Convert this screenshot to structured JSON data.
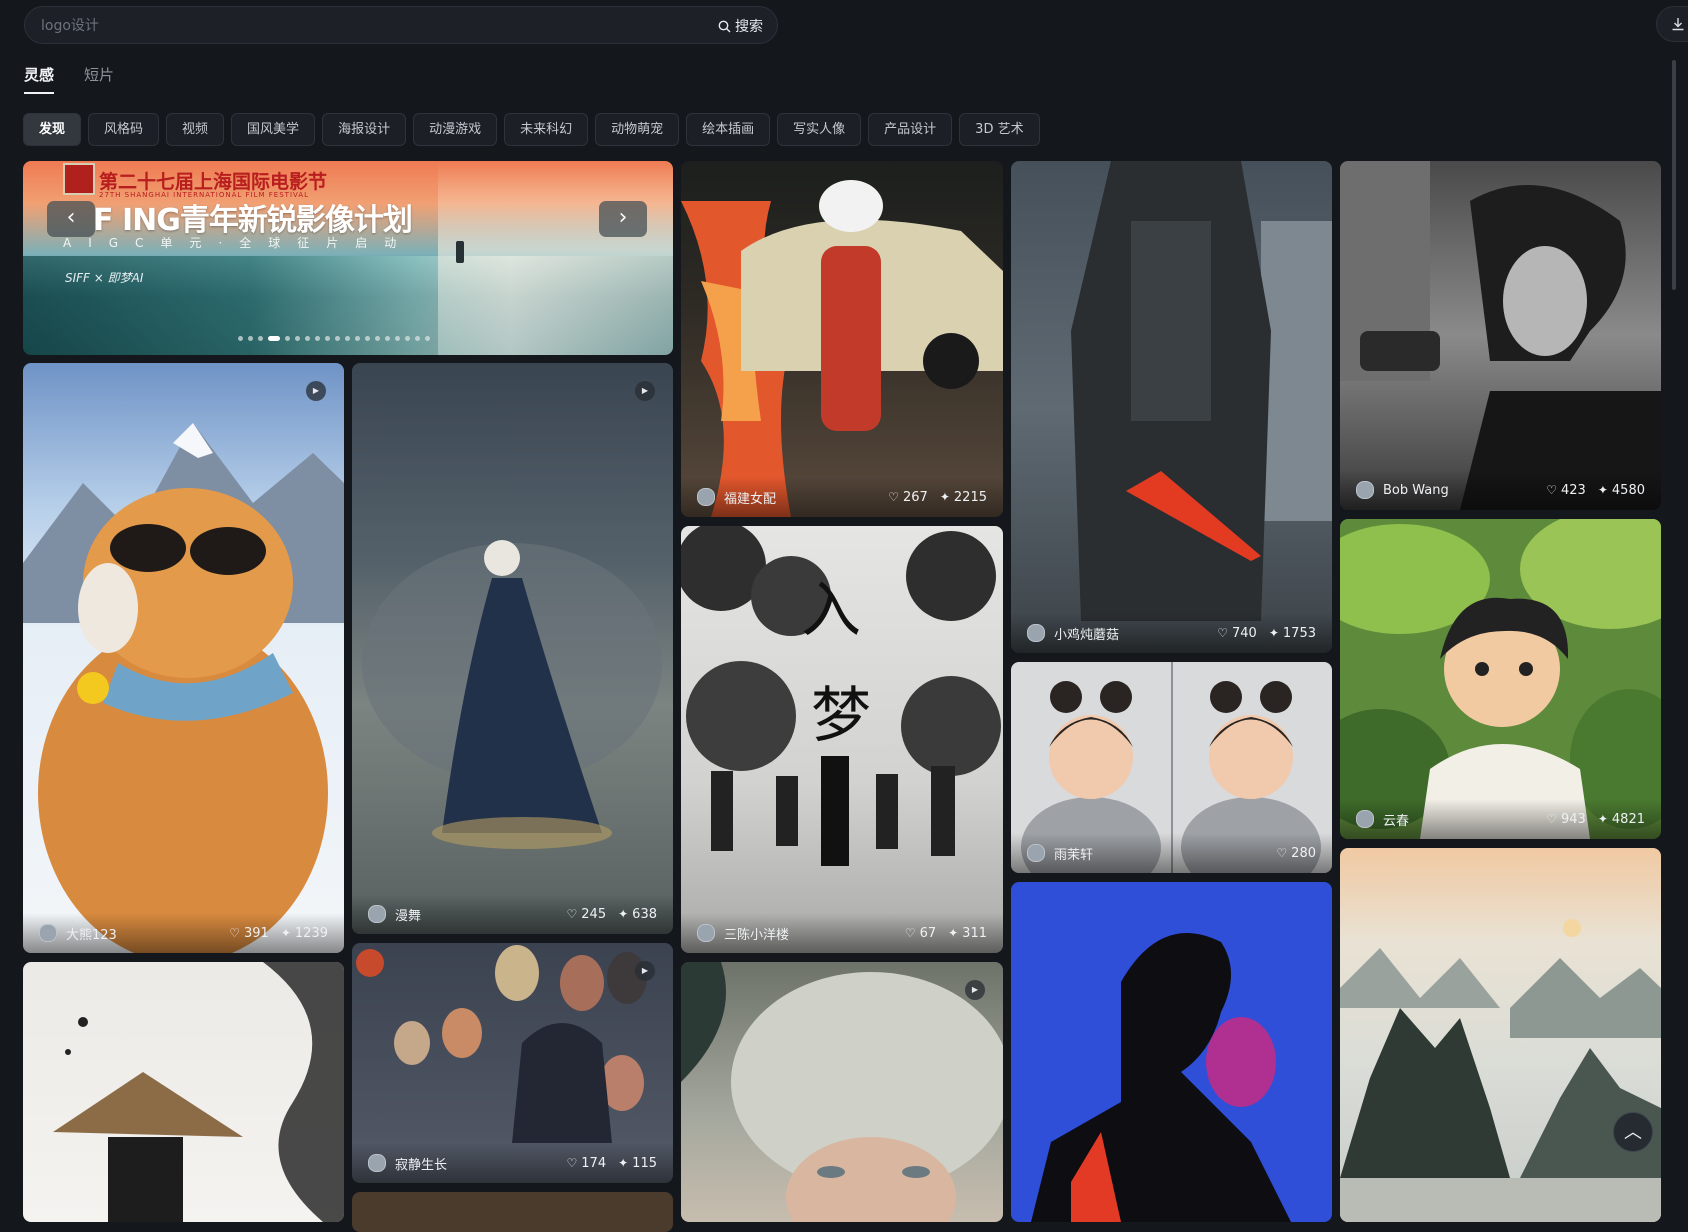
{
  "search": {
    "placeholder": "logo设计",
    "button_label": "搜索"
  },
  "tabs": [
    {
      "label": "灵感"
    },
    {
      "label": "短片"
    }
  ],
  "categories": [
    {
      "label": "发现"
    },
    {
      "label": "风格码"
    },
    {
      "label": "视频"
    },
    {
      "label": "国风美学"
    },
    {
      "label": "海报设计"
    },
    {
      "label": "动漫游戏"
    },
    {
      "label": "未来科幻"
    },
    {
      "label": "动物萌宠"
    },
    {
      "label": "绘本插画"
    },
    {
      "label": "写实人像"
    },
    {
      "label": "产品设计"
    },
    {
      "label": "3D 艺术"
    }
  ],
  "banner": {
    "festival_title": "第二十七届上海国际电影节",
    "festival_en": "27TH SHANGHAI INTERNATIONAL FILM FESTIVAL",
    "headline": "F ING青年新锐影像计划",
    "subline": "AIGC单元·全球征片启动",
    "brand": "SIFF × 即梦AI",
    "slide_count": 19,
    "active_slide": 3
  },
  "cards": [
    {
      "author": "大熊123",
      "likes": "391",
      "uses": "1239",
      "has_video": true
    },
    {
      "author": "漫舞",
      "likes": "245",
      "uses": "638",
      "has_video": true
    },
    {
      "author": "福建女配",
      "likes": "267",
      "uses": "2215",
      "has_video": false
    },
    {
      "author": "小鸡炖蘑菇",
      "likes": "740",
      "uses": "1753",
      "has_video": false
    },
    {
      "author": "Bob Wang",
      "likes": "423",
      "uses": "4580",
      "has_video": false
    },
    {
      "author": "三陈小洋楼",
      "likes": "67",
      "uses": "311",
      "has_video": false
    },
    {
      "author": "雨茉轩",
      "likes": "",
      "uses": "280",
      "has_video": false
    },
    {
      "author": "云春",
      "likes": "943",
      "uses": "4821",
      "has_video": false
    },
    {
      "author": "寂静生长",
      "likes": "174",
      "uses": "115",
      "has_video": true
    }
  ],
  "colors": {
    "background": "#14171c",
    "chip": "#1c2026",
    "chip_active": "#33383f",
    "accent_red": "#e23a24"
  },
  "icons": {
    "search": "search-icon",
    "like": "heart-icon",
    "use": "sparkle-icon",
    "play": "play-icon",
    "download": "download-icon",
    "back_to_top": "chevron-up-icon"
  }
}
